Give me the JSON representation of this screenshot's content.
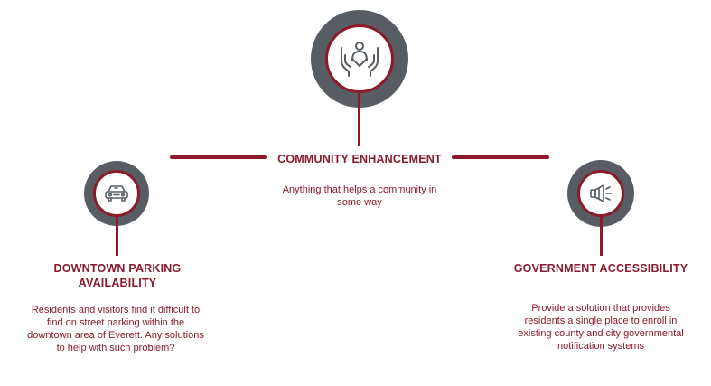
{
  "colors": {
    "accent": "#8b1a2b",
    "ring": "#575d63",
    "icon": "#575d63"
  },
  "nodes": {
    "center": {
      "icon": "community-hands-icon",
      "title": "COMMUNITY ENHANCEMENT",
      "description": "Anything that helps a community in some way"
    },
    "left": {
      "icon": "car-icon",
      "title_line1": "DOWNTOWN PARKING",
      "title_line2": "AVAILABILITY",
      "description": "Residents and visitors find it difficult to find on street parking within the downtown area of Everett. Any solutions to help with such problem?"
    },
    "right": {
      "icon": "megaphone-icon",
      "title": "GOVERNMENT ACCESSIBILITY",
      "description": "Provide a solution that provides residents a single place to enroll in existing county and city governmental notification systems"
    }
  }
}
